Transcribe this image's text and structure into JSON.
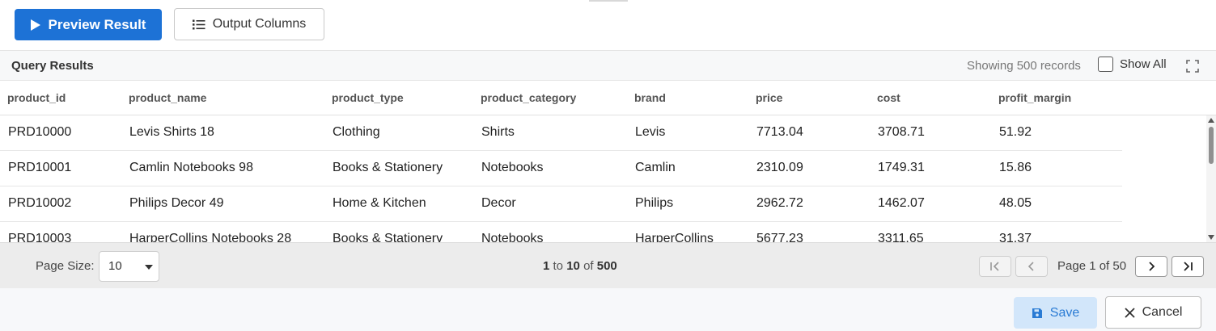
{
  "toolbar": {
    "preview_label": "Preview Result",
    "output_columns_label": "Output Columns"
  },
  "results": {
    "title": "Query Results",
    "records_text": "Showing 500 records",
    "show_all_label": "Show All",
    "show_all_checked": false
  },
  "table": {
    "columns": [
      "product_id",
      "product_name",
      "product_type",
      "product_category",
      "brand",
      "price",
      "cost",
      "profit_margin"
    ],
    "rows": [
      [
        "PRD10000",
        "Levis Shirts 18",
        "Clothing",
        "Shirts",
        "Levis",
        "7713.04",
        "3708.71",
        "51.92"
      ],
      [
        "PRD10001",
        "Camlin Notebooks 98",
        "Books & Stationery",
        "Notebooks",
        "Camlin",
        "2310.09",
        "1749.31",
        "15.86"
      ],
      [
        "PRD10002",
        "Philips Decor 49",
        "Home & Kitchen",
        "Decor",
        "Philips",
        "2962.72",
        "1462.07",
        "48.05"
      ],
      [
        "PRD10003",
        "HarperCollins Notebooks 28",
        "Books & Stationery",
        "Notebooks",
        "HarperCollins",
        "5677.23",
        "3311.65",
        "31.37"
      ]
    ]
  },
  "pager": {
    "page_size_label": "Page Size:",
    "page_size_value": "10",
    "range_start": "1",
    "range_to": "to",
    "range_end": "10",
    "range_of": "of",
    "range_total": "500",
    "page_info": "Page 1 of 50"
  },
  "footer": {
    "save_label": "Save",
    "cancel_label": "Cancel"
  },
  "colors": {
    "primary": "#1d72d6",
    "save_bg": "#d2e6fa",
    "save_text": "#2a7bd4"
  }
}
